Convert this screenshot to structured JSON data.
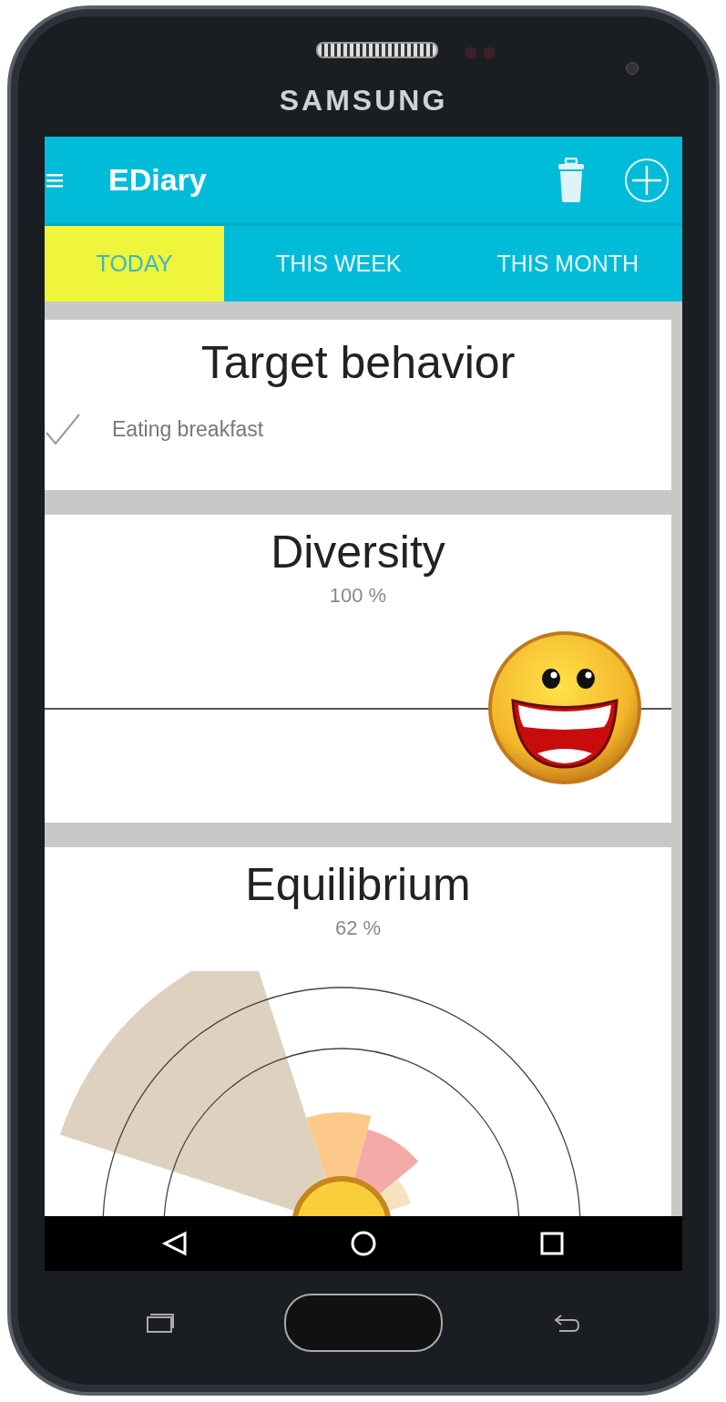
{
  "device": {
    "brand": "SAMSUNG"
  },
  "app_bar": {
    "title": "EDiary"
  },
  "tabs": [
    {
      "label": "TODAY",
      "selected": true
    },
    {
      "label": "THIS WEEK",
      "selected": false
    },
    {
      "label": "THIS MONTH",
      "selected": false
    }
  ],
  "cards": [
    {
      "kind": "checklist",
      "title": "Target behavior",
      "items": [
        {
          "label": "Eating breakfast",
          "checked": true
        }
      ]
    },
    {
      "kind": "slider",
      "title": "Diversity",
      "reading": "100 %",
      "level": 1
    },
    {
      "kind": "radial",
      "title": "Equilibrium",
      "reading": "62 %"
    }
  ]
}
